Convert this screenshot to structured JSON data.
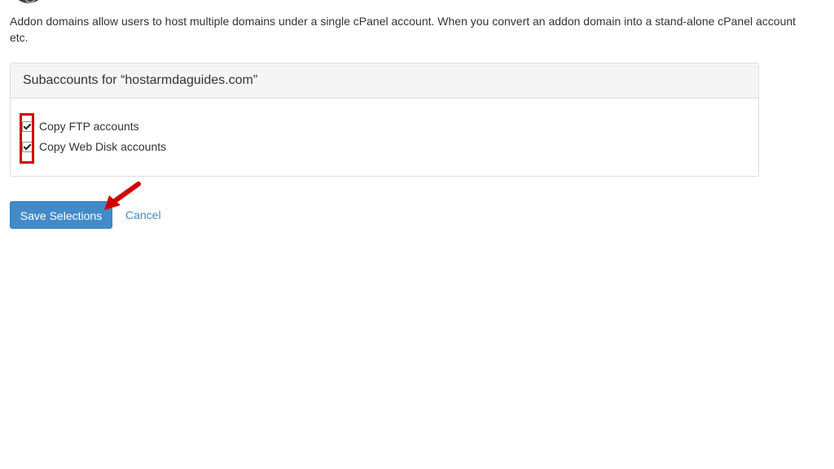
{
  "intro": {
    "line1": "Addon domains allow users to host multiple domains under a single cPanel account. When you convert an addon domain into a stand-alone cPanel account",
    "line2": "etc."
  },
  "panel": {
    "heading": "Subaccounts for “hostarmdaguides.com”",
    "options": [
      {
        "label": "Copy FTP accounts",
        "checked": true
      },
      {
        "label": "Copy Web Disk accounts",
        "checked": true
      }
    ]
  },
  "actions": {
    "save_label": "Save Selections",
    "cancel_label": "Cancel"
  },
  "colors": {
    "primary": "#428bca",
    "annotation": "#d10000"
  },
  "icons": {
    "top": "domain-icon",
    "annotation_arrow": "arrow-pointer-icon"
  }
}
